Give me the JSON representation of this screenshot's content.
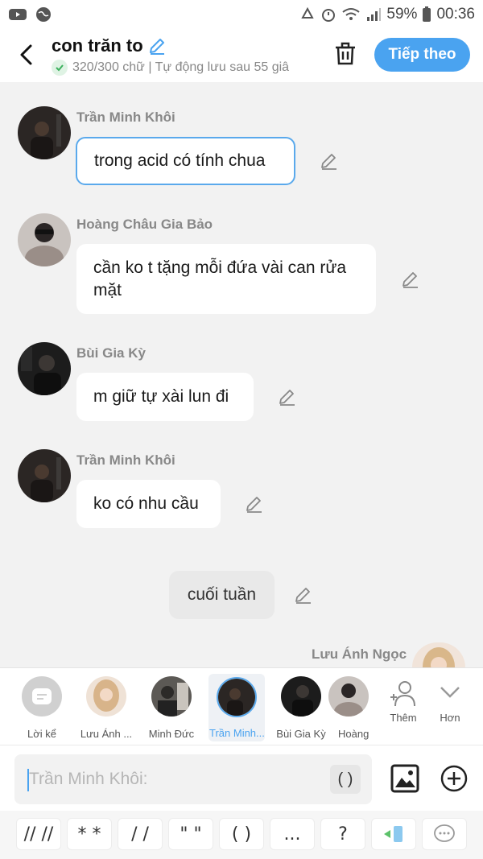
{
  "status_bar": {
    "battery": "59%",
    "time": "00:36"
  },
  "header": {
    "title": "con trăn to",
    "subtitle": "320/300 chữ | Tự động lưu sau 55 giâ",
    "next_label": "Tiếp theo"
  },
  "messages": [
    {
      "sender": "Trần Minh Khôi",
      "text": "trong acid có tính chua"
    },
    {
      "sender": "Hoàng Châu Gia Bảo",
      "text": "cần ko t tặng mỗi đứa vài can rửa mặt"
    },
    {
      "sender": "Bùi Gia Kỳ",
      "text": "m giữ tự xài lun đi"
    },
    {
      "sender": "Trần Minh Khôi",
      "text": "ko có nhu cầu"
    }
  ],
  "narration": {
    "text": "cuối tuần"
  },
  "last_sender": "Lưu Ánh Ngọc",
  "characters": [
    {
      "name": "Lời kể"
    },
    {
      "name": "Lưu Ánh ..."
    },
    {
      "name": "Minh Đức"
    },
    {
      "name": "Trần Minh..."
    },
    {
      "name": "Bùi Gia Kỳ"
    },
    {
      "name": "Hoàng"
    }
  ],
  "more": {
    "add_label": "Thêm",
    "more_label": "Hơn"
  },
  "input": {
    "placeholder": "Trần Minh Khôi:",
    "paren_label": "( )"
  },
  "toolbar": {
    "keys": [
      "// //",
      "* *",
      "/ /",
      "\" \"",
      "( )",
      "...",
      "?"
    ]
  },
  "colors": {
    "accent": "#4aa3f0",
    "bubble": "#ffffff",
    "background": "#f2f2f2"
  }
}
